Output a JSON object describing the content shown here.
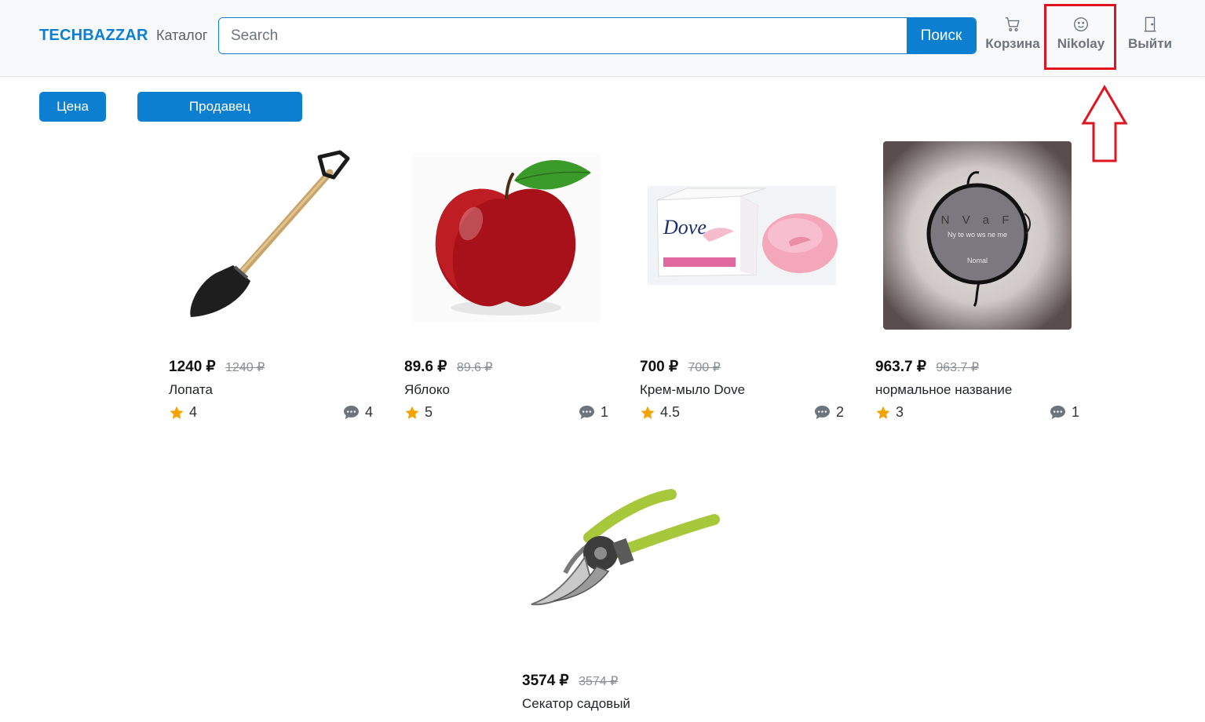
{
  "header": {
    "brand": "TECHBAZZAR",
    "catalog_link": "Каталог",
    "search_placeholder": "Search",
    "search_button": "Поиск",
    "cart_label": "Корзина",
    "user_label": "Nikolay",
    "logout_label": "Выйти"
  },
  "filters": {
    "price_label": "Цена",
    "seller_label": "Продавец"
  },
  "colors": {
    "brand": "#0d7fd0",
    "highlight": "#e0141e",
    "star": "#f5a300"
  },
  "products": [
    {
      "price": "1240 ₽",
      "old_price": "1240 ₽",
      "name": "Лопата",
      "rating": "4",
      "reviews": "4",
      "image_icon": "shovel-image"
    },
    {
      "price": "89.6 ₽",
      "old_price": "89.6 ₽",
      "name": "Яблоко",
      "rating": "5",
      "reviews": "1",
      "image_icon": "apple-image"
    },
    {
      "price": "700 ₽",
      "old_price": "700 ₽",
      "name": "Крем-мыло Dove",
      "rating": "4.5",
      "reviews": "2",
      "image_icon": "soap-image"
    },
    {
      "price": "963.7 ₽",
      "old_price": "963.7 ₽",
      "name": "нормальное название",
      "rating": "3",
      "reviews": "1",
      "image_icon": "logo-image"
    },
    {
      "price": "3574 ₽",
      "old_price": "3574 ₽",
      "name": "Секатор садовый",
      "rating": "",
      "reviews": "",
      "image_icon": "pruner-image"
    }
  ],
  "images": {
    "dove_text": "Dove",
    "logo_letters": "N V a F",
    "logo_line1": "Ny te wo ws ne me",
    "logo_line2": "Nomal"
  }
}
